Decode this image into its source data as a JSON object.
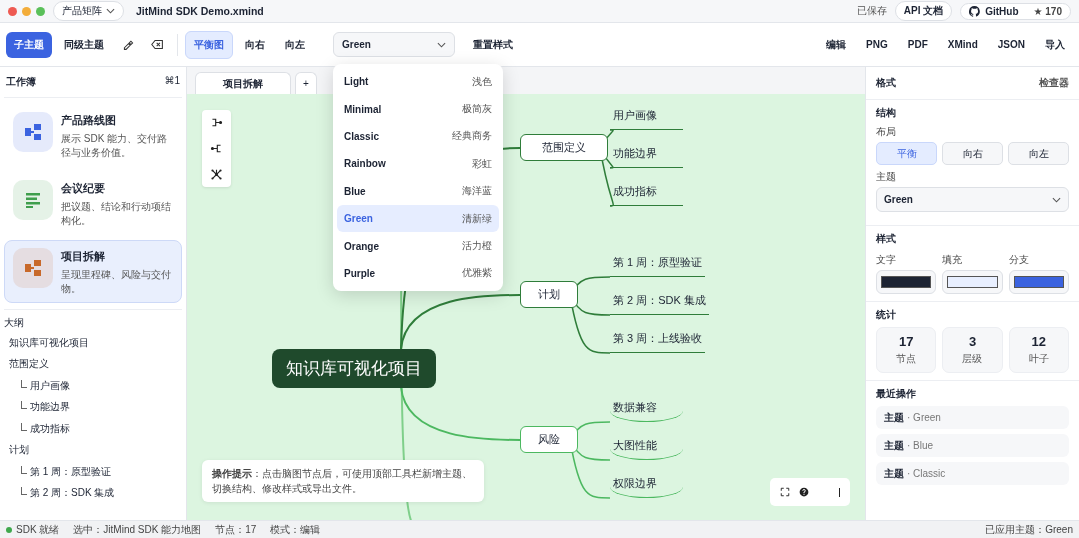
{
  "titlebar": {
    "workspace": "产品矩阵",
    "filename": "JitMind SDK Demo.xmind",
    "saved": "已保存",
    "api_button": "API 文档",
    "github_button": "GitHub",
    "stars": "★ 170"
  },
  "toolbar": {
    "actions": [
      {
        "label": "子主题",
        "primary": true
      },
      {
        "label": "同级主题",
        "primary": false
      }
    ],
    "layouts": [
      {
        "label": "平衡图",
        "selected": true
      },
      {
        "label": "向右",
        "selected": false
      },
      {
        "label": "向左",
        "selected": false
      }
    ],
    "theme_select": "Green",
    "reset": "重置样式",
    "theme_options": [
      {
        "name": "Light",
        "note": "浅色",
        "selected": false
      },
      {
        "name": "Minimal",
        "note": "极简灰",
        "selected": false
      },
      {
        "name": "Classic",
        "note": "经典商务",
        "selected": false
      },
      {
        "name": "Rainbow",
        "note": "彩虹",
        "selected": false
      },
      {
        "name": "Blue",
        "note": "海洋蓝",
        "selected": false
      },
      {
        "name": "Green",
        "note": "清新绿",
        "selected": true
      },
      {
        "name": "Orange",
        "note": "活力橙",
        "selected": false
      },
      {
        "name": "Purple",
        "note": "优雅紫",
        "selected": false
      }
    ],
    "exports": [
      "编辑",
      "PNG",
      "PDF",
      "XMind",
      "JSON",
      "导入"
    ]
  },
  "sidebar": {
    "title": "工作簿",
    "shortcut": "⌘1",
    "cards": [
      {
        "title": "产品路线图",
        "desc": "展示 SDK 能力、交付路径与业务价值。",
        "kind": "diagram",
        "color": "#3b63e0",
        "selected": false
      },
      {
        "title": "会议纪要",
        "desc": "把议题、结论和行动项结构化。",
        "kind": "list",
        "color": "#3f9e4d",
        "selected": false
      },
      {
        "title": "项目拆解",
        "desc": "呈现里程碑、风险与交付物。",
        "kind": "diagram",
        "color": "#c8692a",
        "selected": true
      }
    ],
    "outline_title": "大纲",
    "outline": [
      {
        "label": "知识库可视化项目"
      },
      {
        "label": "范围定义",
        "children": [
          {
            "label": "用户画像"
          },
          {
            "label": "功能边界"
          },
          {
            "label": "成功指标"
          }
        ]
      },
      {
        "label": "计划",
        "children": [
          {
            "label": "第 1 周：原型验证"
          },
          {
            "label": "第 2 周：SDK 集成"
          }
        ]
      }
    ]
  },
  "canvas": {
    "tabs": [
      {
        "label": "项目拆解",
        "selected": true
      }
    ],
    "add_tab": "+",
    "root": "知识库可视化项目",
    "branches": [
      {
        "label": "范围定义",
        "children": [
          "用户画像",
          "功能边界",
          "成功指标"
        ]
      },
      {
        "label": "计划",
        "children": [
          "第 1 周：原型验证",
          "第 2 周：SDK 集成",
          "第 3 周：上线验收"
        ]
      },
      {
        "label": "风险",
        "children": [
          "数据兼容",
          "大图性能",
          "权限边界"
        ]
      }
    ],
    "hint": "**操作提示**：点击脑图节点后，可使用顶部工具栏新增主题、切换结构、修改样式或导出文件。"
  },
  "inspector": {
    "title": "格式",
    "subtitle": "检查器",
    "structure_title": "结构",
    "layout_label": "布局",
    "layouts": [
      {
        "label": "平衡",
        "selected": true
      },
      {
        "label": "向右",
        "selected": false
      },
      {
        "label": "向左",
        "selected": false
      }
    ],
    "theme_label": "主题",
    "theme_value": "Green",
    "style_title": "样式",
    "swatches": [
      {
        "label": "文字",
        "color": "#1c2333"
      },
      {
        "label": "填充",
        "color": "#e8efff"
      },
      {
        "label": "分支",
        "color": "#3b63e0"
      }
    ],
    "stats_title": "统计",
    "stats": [
      {
        "value": "17",
        "label": "节点"
      },
      {
        "value": "3",
        "label": "层级"
      },
      {
        "value": "12",
        "label": "叶子"
      }
    ],
    "recent_title": "最近操作",
    "recent": [
      {
        "key": "主题",
        "value": "· Green"
      },
      {
        "key": "主题",
        "value": "· Blue"
      },
      {
        "key": "主题",
        "value": "· Classic"
      }
    ]
  },
  "status_bar": {
    "ready": "SDK 就绪",
    "selection": "选中：JitMind SDK 能力地图",
    "nodes": "节点：17",
    "mode": "模式：编辑",
    "applied": "已应用主题：Green"
  }
}
